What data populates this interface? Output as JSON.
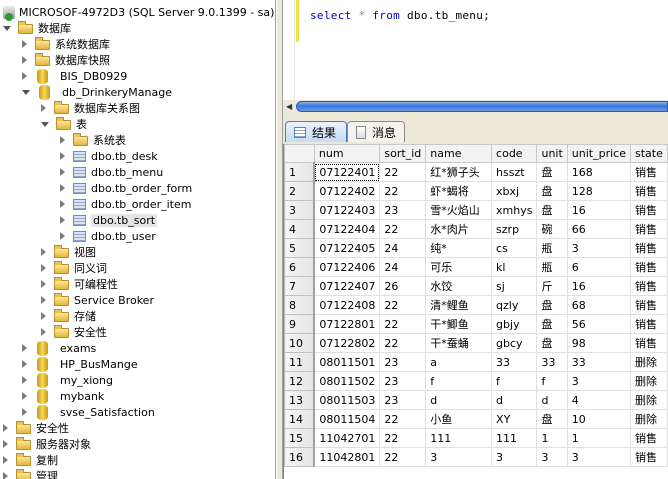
{
  "tree": [
    {
      "label": "MICROSOF-4972D3 (SQL Server 9.0.1399 - sa)",
      "level": 0,
      "icon": "server",
      "state": "none"
    },
    {
      "label": "数据库",
      "level": 0,
      "icon": "folder",
      "state": "expanded"
    },
    {
      "label": "系统数据库",
      "level": 1,
      "icon": "folder",
      "state": "collapsed"
    },
    {
      "label": "数据库快照",
      "level": 1,
      "icon": "folder",
      "state": "collapsed"
    },
    {
      "label": "BIS_DB0929",
      "level": 1,
      "icon": "db",
      "state": "collapsed"
    },
    {
      "label": "db_DrinkeryManage",
      "level": 1,
      "icon": "db",
      "state": "expanded"
    },
    {
      "label": "数据库关系图",
      "level": 2,
      "icon": "folder",
      "state": "collapsed"
    },
    {
      "label": "表",
      "level": 2,
      "icon": "folder",
      "state": "expanded"
    },
    {
      "label": "系统表",
      "level": 3,
      "icon": "folder",
      "state": "collapsed"
    },
    {
      "label": "dbo.tb_desk",
      "level": 3,
      "icon": "table",
      "state": "collapsed"
    },
    {
      "label": "dbo.tb_menu",
      "level": 3,
      "icon": "table",
      "state": "collapsed"
    },
    {
      "label": "dbo.tb_order_form",
      "level": 3,
      "icon": "table",
      "state": "collapsed"
    },
    {
      "label": "dbo.tb_order_item",
      "level": 3,
      "icon": "table",
      "state": "collapsed"
    },
    {
      "label": "dbo.tb_sort",
      "level": 3,
      "icon": "table",
      "state": "collapsed",
      "selected": true
    },
    {
      "label": "dbo.tb_user",
      "level": 3,
      "icon": "table",
      "state": "collapsed"
    },
    {
      "label": "视图",
      "level": 2,
      "icon": "folder",
      "state": "collapsed"
    },
    {
      "label": "同义词",
      "level": 2,
      "icon": "folder",
      "state": "collapsed"
    },
    {
      "label": "可编程性",
      "level": 2,
      "icon": "folder",
      "state": "collapsed"
    },
    {
      "label": "Service Broker",
      "level": 2,
      "icon": "folder",
      "state": "collapsed"
    },
    {
      "label": "存储",
      "level": 2,
      "icon": "folder",
      "state": "collapsed"
    },
    {
      "label": "安全性",
      "level": 2,
      "icon": "folder",
      "state": "collapsed"
    },
    {
      "label": "exams",
      "level": 1,
      "icon": "db",
      "state": "collapsed"
    },
    {
      "label": "HP_BusMange",
      "level": 1,
      "icon": "db",
      "state": "collapsed"
    },
    {
      "label": "my_xiong",
      "level": 1,
      "icon": "db",
      "state": "collapsed"
    },
    {
      "label": "mybank",
      "level": 1,
      "icon": "db",
      "state": "collapsed"
    },
    {
      "label": "svse_Satisfaction",
      "level": 1,
      "icon": "db",
      "state": "collapsed"
    },
    {
      "label": "安全性",
      "level": 0,
      "icon": "folder",
      "state": "collapsed"
    },
    {
      "label": "服务器对象",
      "level": 0,
      "icon": "folder",
      "state": "collapsed"
    },
    {
      "label": "复制",
      "level": 0,
      "icon": "folder",
      "state": "collapsed"
    },
    {
      "label": "管理",
      "level": 0,
      "icon": "folder",
      "state": "collapsed"
    }
  ],
  "editor": {
    "kw1": "select",
    "star": "*",
    "kw2": "from",
    "rest": "dbo.tb_menu;"
  },
  "tabs": {
    "results": "结果",
    "messages": "消息"
  },
  "grid": {
    "columns": [
      "num",
      "sort_id",
      "name",
      "code",
      "unit",
      "unit_price",
      "state"
    ],
    "rows": [
      [
        "07122401",
        "22",
        "红*狮子头",
        "hsszt",
        "盘",
        "168",
        "销售"
      ],
      [
        "07122402",
        "22",
        "虾*蝎将",
        "xbxj",
        "盘",
        "128",
        "销售"
      ],
      [
        "07122403",
        "23",
        "雪*火焰山",
        "xmhys",
        "盘",
        "16",
        "销售"
      ],
      [
        "07122404",
        "22",
        "水*肉片",
        "szrp",
        "碗",
        "66",
        "销售"
      ],
      [
        "07122405",
        "24",
        "纯*",
        "cs",
        "瓶",
        "3",
        "销售"
      ],
      [
        "07122406",
        "24",
        "可乐",
        "kl",
        "瓶",
        "6",
        "销售"
      ],
      [
        "07122407",
        "26",
        "水饺",
        "sj",
        "斤",
        "16",
        "销售"
      ],
      [
        "07122408",
        "22",
        "清*鲤鱼",
        "qzly",
        "盘",
        "68",
        "销售"
      ],
      [
        "07122801",
        "22",
        "干*鲫鱼",
        "gbjy",
        "盘",
        "56",
        "销售"
      ],
      [
        "07122802",
        "22",
        "干*蚕蛹",
        "gbcy",
        "盘",
        "98",
        "销售"
      ],
      [
        "08011501",
        "23",
        "a",
        "33",
        "33",
        "33",
        "删除"
      ],
      [
        "08011502",
        "23",
        "f",
        "f",
        "f",
        "3",
        "删除"
      ],
      [
        "08011503",
        "23",
        "d",
        "d",
        "d",
        "4",
        "删除"
      ],
      [
        "08011504",
        "22",
        "小鱼",
        "XY",
        "盘",
        "10",
        "删除"
      ],
      [
        "11042701",
        "22",
        "111",
        "111",
        "1",
        "1",
        "销售"
      ],
      [
        "11042801",
        "22",
        "3",
        "3",
        "3",
        "3",
        "销售"
      ]
    ]
  }
}
